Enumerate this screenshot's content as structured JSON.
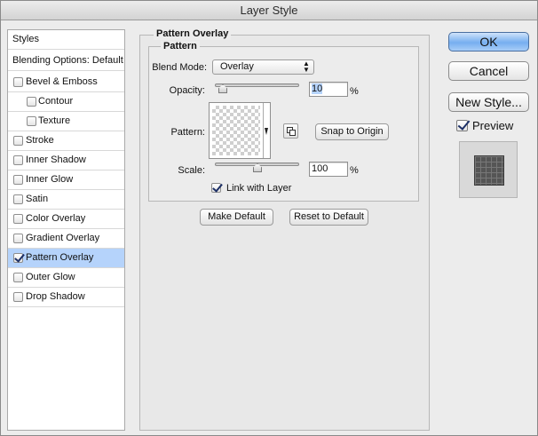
{
  "window": {
    "title": "Layer Style"
  },
  "sidebar": {
    "styles_label": "Styles",
    "blending_label": "Blending Options: Default",
    "items": [
      {
        "label": "Bevel & Emboss",
        "checked": false,
        "indent": false
      },
      {
        "label": "Contour",
        "checked": false,
        "indent": true
      },
      {
        "label": "Texture",
        "checked": false,
        "indent": true
      },
      {
        "label": "Stroke",
        "checked": false,
        "indent": false
      },
      {
        "label": "Inner Shadow",
        "checked": false,
        "indent": false
      },
      {
        "label": "Inner Glow",
        "checked": false,
        "indent": false
      },
      {
        "label": "Satin",
        "checked": false,
        "indent": false
      },
      {
        "label": "Color Overlay",
        "checked": false,
        "indent": false
      },
      {
        "label": "Gradient Overlay",
        "checked": false,
        "indent": false
      },
      {
        "label": "Pattern Overlay",
        "checked": true,
        "indent": false,
        "selected": true
      },
      {
        "label": "Outer Glow",
        "checked": false,
        "indent": false
      },
      {
        "label": "Drop Shadow",
        "checked": false,
        "indent": false
      }
    ]
  },
  "panel": {
    "group_title": "Pattern Overlay",
    "subgroup_title": "Pattern",
    "blend_mode_label": "Blend Mode:",
    "blend_mode_value": "Overlay",
    "opacity_label": "Opacity:",
    "opacity_value": "10",
    "opacity_unit": "%",
    "pattern_label": "Pattern:",
    "snap_button": "Snap to Origin",
    "scale_label": "Scale:",
    "scale_value": "100",
    "scale_unit": "%",
    "link_label": "Link with Layer",
    "link_checked": true,
    "make_default_button": "Make Default",
    "reset_default_button": "Reset to Default"
  },
  "actions": {
    "ok": "OK",
    "cancel": "Cancel",
    "new_style": "New Style...",
    "preview_label": "Preview",
    "preview_checked": true
  },
  "colors": {
    "selected_row": "#b5d3fb",
    "default_button": "#76aef0"
  }
}
